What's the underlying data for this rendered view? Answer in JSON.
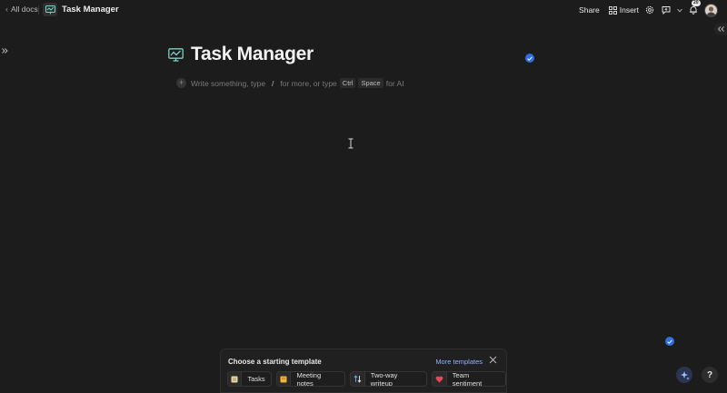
{
  "topbar": {
    "back_label": "All docs",
    "doc_title": "Task Manager",
    "share_label": "Share",
    "insert_label": "Insert",
    "notification_count": "20"
  },
  "page": {
    "title": "Task Manager",
    "placeholder_before": "Write something, type",
    "slash_key": "/",
    "placeholder_mid": "for more, or type",
    "key_ctrl": "Ctrl",
    "key_space": "Space",
    "placeholder_after": "for AI"
  },
  "templates": {
    "header": "Choose a starting template",
    "more_label": "More templates",
    "options": [
      {
        "label": "Tasks",
        "icon": "tasks-icon"
      },
      {
        "label": "Meeting notes",
        "icon": "notes-icon"
      },
      {
        "label": "Two-way writeup",
        "icon": "two-way-icon"
      },
      {
        "label": "Team sentiment",
        "icon": "heart-icon"
      }
    ]
  },
  "help_label": "?",
  "colors": {
    "background": "#1c1c1c",
    "accent_blue": "#2f6fe0",
    "link": "#8fb3ff",
    "doc_icon": "#7fd0c0"
  }
}
